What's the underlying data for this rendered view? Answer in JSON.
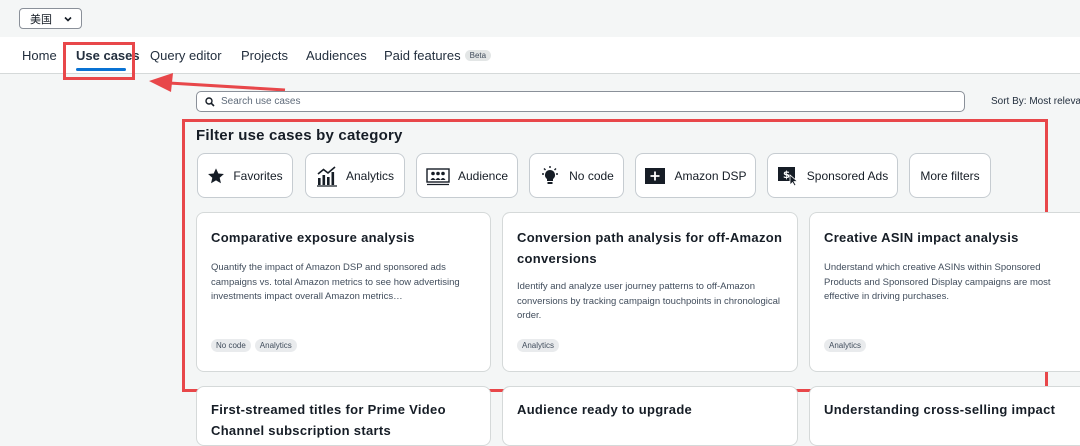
{
  "region": {
    "value": "美国"
  },
  "nav": {
    "items": [
      {
        "label": "Home"
      },
      {
        "label": "Use cases"
      },
      {
        "label": "Query editor"
      },
      {
        "label": "Projects"
      },
      {
        "label": "Audiences"
      },
      {
        "label": "Paid features",
        "badge": "Beta"
      }
    ],
    "active": "Use cases"
  },
  "search": {
    "placeholder": "Search use cases"
  },
  "sort": {
    "label": "Sort By: Most releva"
  },
  "filters": {
    "title": "Filter use cases by category",
    "chips": [
      {
        "label": "Favorites",
        "icon": "star-icon"
      },
      {
        "label": "Analytics",
        "icon": "analytics-icon"
      },
      {
        "label": "Audience",
        "icon": "audience-icon"
      },
      {
        "label": "No code",
        "icon": "lightbulb-icon"
      },
      {
        "label": "Amazon DSP",
        "icon": "dsp-icon"
      },
      {
        "label": "Sponsored Ads",
        "icon": "sponsored-ads-icon"
      },
      {
        "label": "More filters",
        "icon": ""
      }
    ]
  },
  "cards": [
    {
      "title": "Comparative exposure analysis",
      "description": "Quantify the impact of Amazon DSP and sponsored ads campaigns vs. total Amazon metrics to see how advertising investments impact overall Amazon metrics…",
      "tags": [
        "No code",
        "Analytics"
      ]
    },
    {
      "title": "Conversion path analysis for off-Amazon conversions",
      "description": "Identify and analyze user journey patterns to off-Amazon conversions by tracking campaign touchpoints in chronological order.",
      "tags": [
        "Analytics"
      ]
    },
    {
      "title": "Creative ASIN impact analysis",
      "description": "Understand which creative ASINs within Sponsored Products and Sponsored Display campaigns are most effective in driving purchases.",
      "tags": [
        "Analytics"
      ]
    },
    {
      "title": "First-streamed titles for Prime Video Channel subscription starts",
      "description": "",
      "tags": []
    },
    {
      "title": "Audience ready to upgrade",
      "description": "",
      "tags": []
    },
    {
      "title": "Understanding cross-selling impact",
      "description": "",
      "tags": []
    }
  ],
  "colors": {
    "accent": "#0972d3",
    "annotation": "#e8474a",
    "background": "#f4f6f6"
  }
}
